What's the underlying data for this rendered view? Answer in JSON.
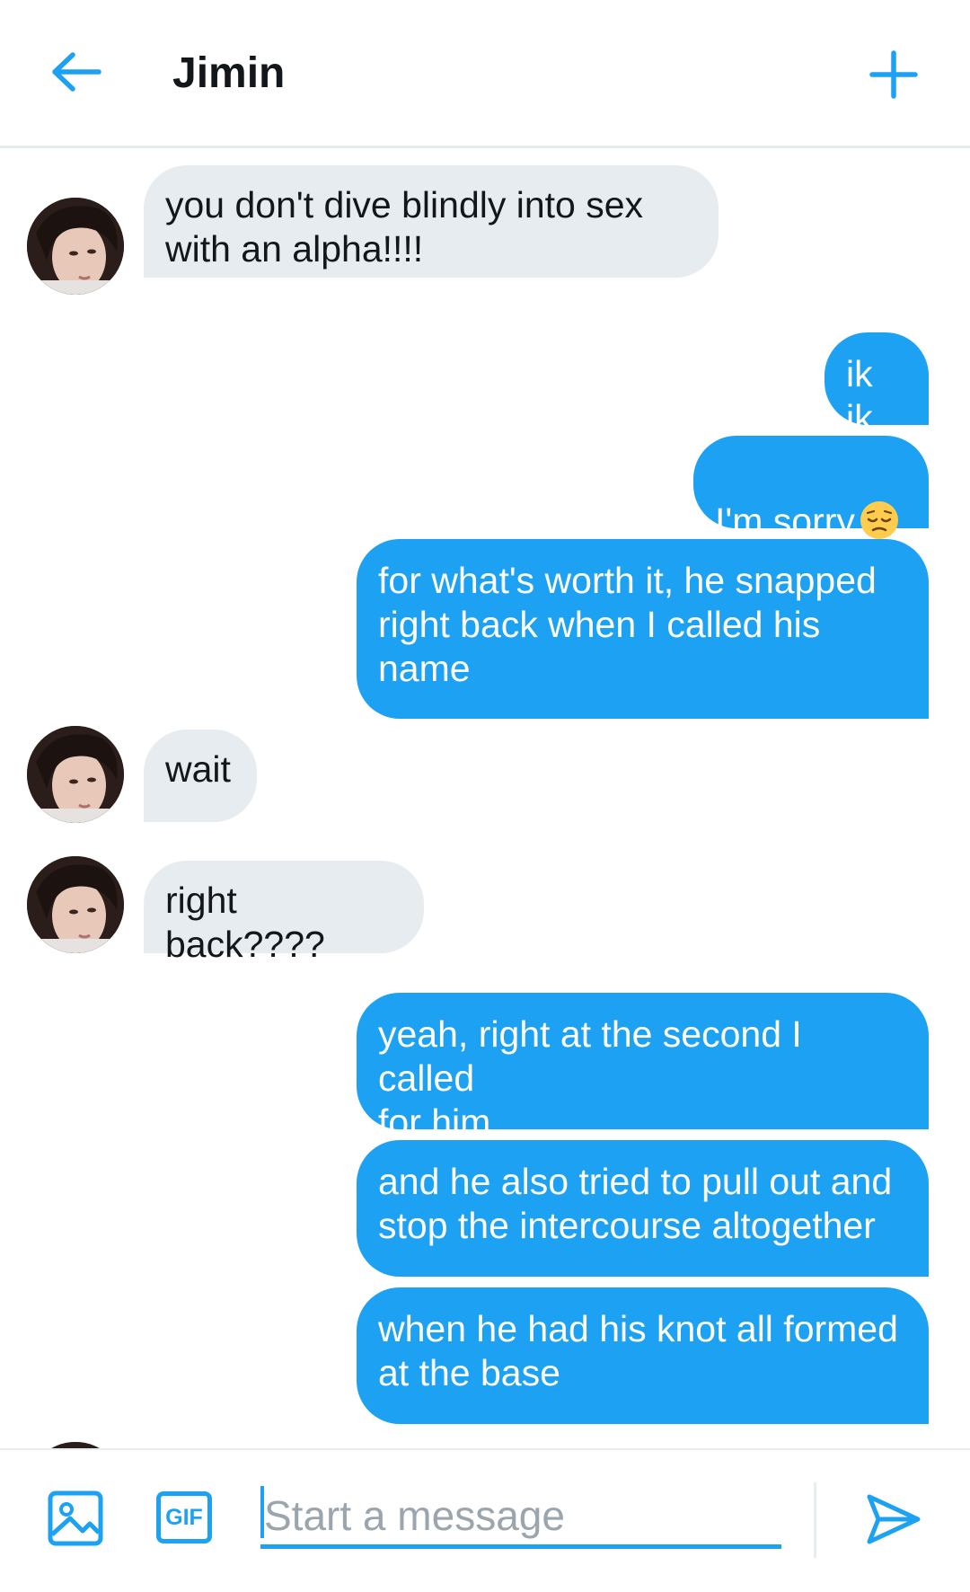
{
  "header": {
    "title": "Jimin",
    "back_icon": "arrow-left-icon",
    "new_icon": "plus-icon",
    "accent_color": "#1da1f2"
  },
  "messages": [
    {
      "direction": "incoming",
      "text": "you don't dive blindly into sex\nwith an alpha!!!!",
      "avatar": true
    },
    {
      "direction": "outgoing",
      "text": "ik ik"
    },
    {
      "direction": "outgoing",
      "text": "I'm sorry",
      "emoji": "pensive-face-icon"
    },
    {
      "direction": "outgoing",
      "text": "for what's worth it, he snapped\nright back when I called his\nname"
    },
    {
      "direction": "incoming",
      "text": "wait",
      "avatar": true
    },
    {
      "direction": "incoming",
      "text": "right back????",
      "avatar": true
    },
    {
      "direction": "outgoing",
      "text": "yeah, right at the second I called\nfor him"
    },
    {
      "direction": "outgoing",
      "text": "and he also tried to pull out and\nstop the intercourse altogether"
    },
    {
      "direction": "outgoing",
      "text": "when he had his knot all formed\nat the base"
    }
  ],
  "composer": {
    "placeholder": "Start a message",
    "value": "",
    "image_icon": "image-icon",
    "gif_label": "GIF",
    "send_icon": "send-icon"
  },
  "colors": {
    "incoming_bubble": "#e6ecf0",
    "outgoing_bubble": "#1da1f2",
    "text_dark": "#14171a",
    "placeholder": "#9aa5ae"
  }
}
